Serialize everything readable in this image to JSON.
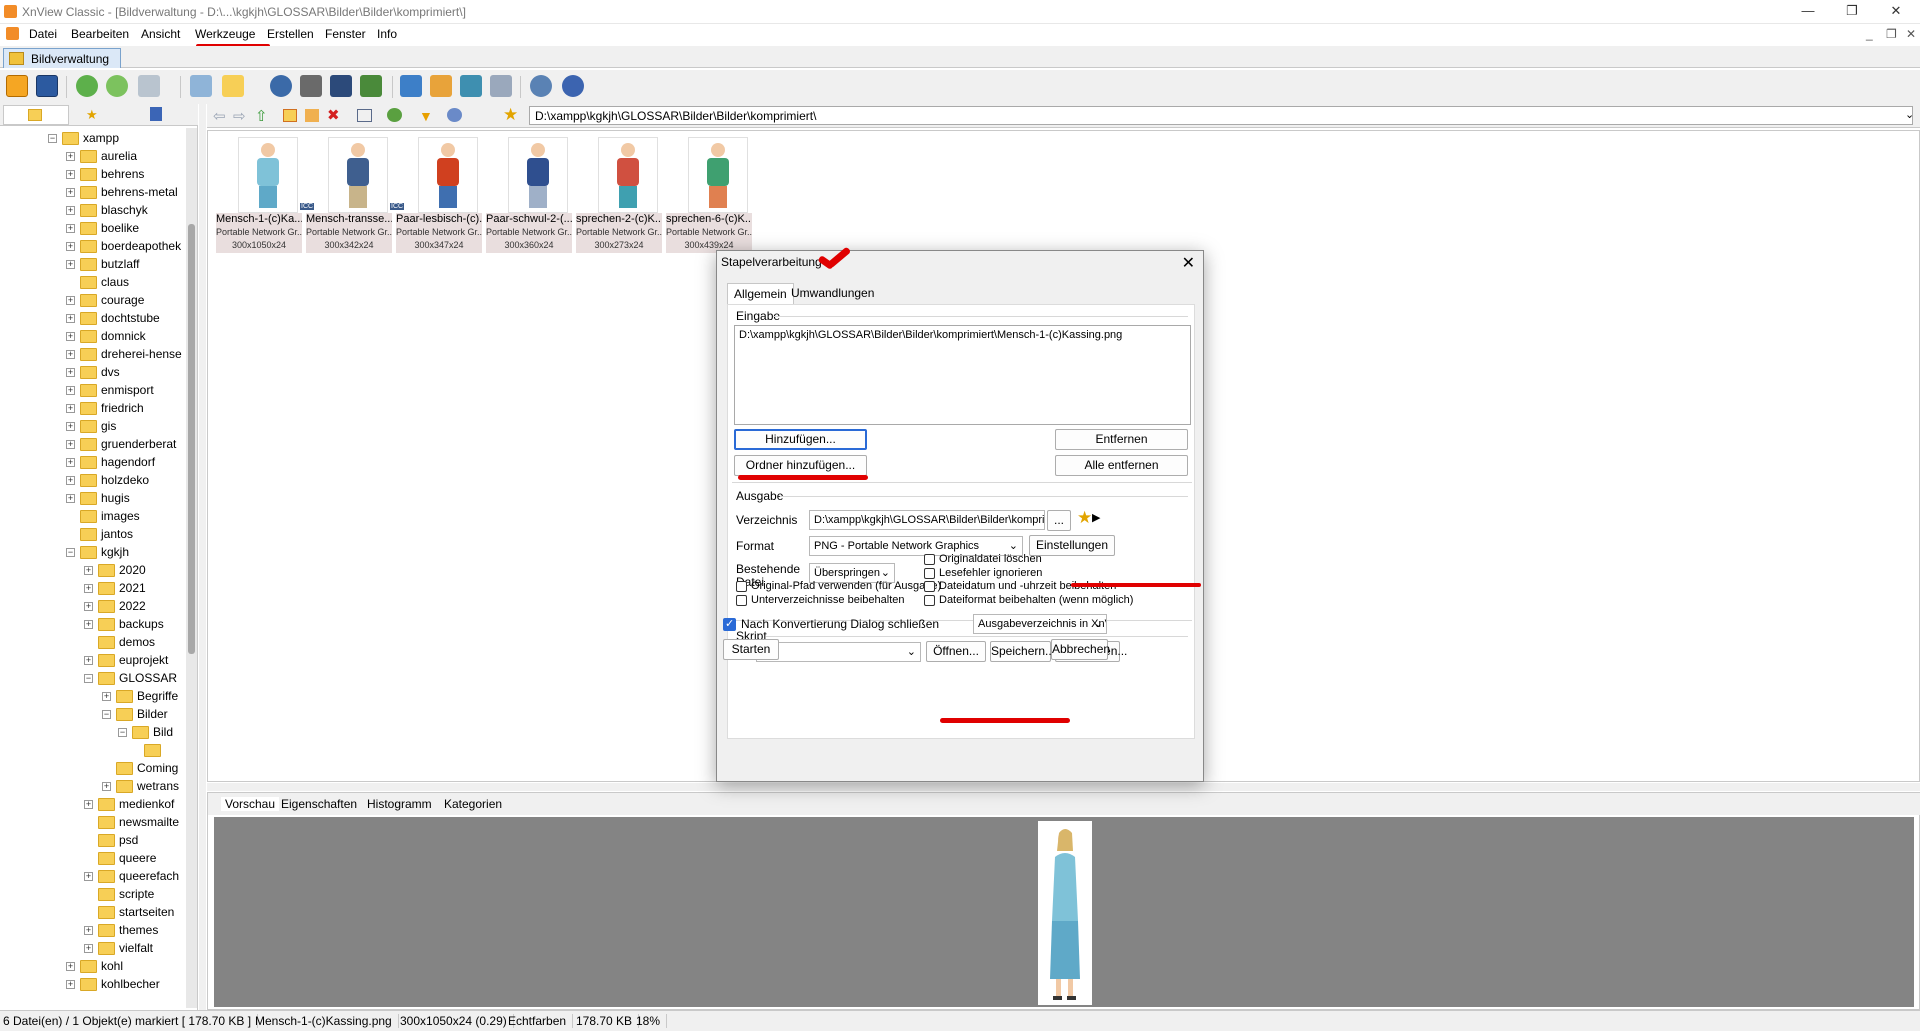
{
  "window": {
    "title": "XnView Classic - [Bildverwaltung - D:\\...\\kgkjh\\GLOSSAR\\Bilder\\Bilder\\komprimiert\\]",
    "controls": [
      "—",
      "❐",
      "✕"
    ],
    "mdi_controls": [
      "_",
      "❐",
      "✕"
    ]
  },
  "menu": [
    "Datei",
    "Bearbeiten",
    "Ansicht",
    "Werkzeuge",
    "Erstellen",
    "Fenster",
    "Info"
  ],
  "doc_tab": "Bildverwaltung",
  "address": "D:\\xampp\\kgkjh\\GLOSSAR\\Bilder\\Bilder\\komprimiert\\",
  "tree": [
    {
      "label": "xampp",
      "level": 0,
      "pm": "−"
    },
    {
      "label": "aurelia",
      "level": 1,
      "pm": "+"
    },
    {
      "label": "behrens",
      "level": 1,
      "pm": "+"
    },
    {
      "label": "behrens-metal",
      "level": 1,
      "pm": "+"
    },
    {
      "label": "blaschyk",
      "level": 1,
      "pm": "+"
    },
    {
      "label": "boelike",
      "level": 1,
      "pm": "+"
    },
    {
      "label": "boerdeapothek",
      "level": 1,
      "pm": "+"
    },
    {
      "label": "butzlaff",
      "level": 1,
      "pm": "+"
    },
    {
      "label": "claus",
      "level": 1,
      "pm": ""
    },
    {
      "label": "courage",
      "level": 1,
      "pm": "+"
    },
    {
      "label": "dochtstube",
      "level": 1,
      "pm": "+"
    },
    {
      "label": "domnick",
      "level": 1,
      "pm": "+"
    },
    {
      "label": "dreherei-hense",
      "level": 1,
      "pm": "+"
    },
    {
      "label": "dvs",
      "level": 1,
      "pm": "+"
    },
    {
      "label": "enmisport",
      "level": 1,
      "pm": "+"
    },
    {
      "label": "friedrich",
      "level": 1,
      "pm": "+"
    },
    {
      "label": "gis",
      "level": 1,
      "pm": "+"
    },
    {
      "label": "gruenderberat",
      "level": 1,
      "pm": "+"
    },
    {
      "label": "hagendorf",
      "level": 1,
      "pm": "+"
    },
    {
      "label": "holzdeko",
      "level": 1,
      "pm": "+"
    },
    {
      "label": "hugis",
      "level": 1,
      "pm": "+"
    },
    {
      "label": "images",
      "level": 1,
      "pm": ""
    },
    {
      "label": "jantos",
      "level": 1,
      "pm": ""
    },
    {
      "label": "kgkjh",
      "level": 1,
      "pm": "−"
    },
    {
      "label": "2020",
      "level": 2,
      "pm": "+"
    },
    {
      "label": "2021",
      "level": 2,
      "pm": "+"
    },
    {
      "label": "2022",
      "level": 2,
      "pm": "+"
    },
    {
      "label": "backups",
      "level": 2,
      "pm": "+"
    },
    {
      "label": "demos",
      "level": 2,
      "pm": ""
    },
    {
      "label": "euprojekt",
      "level": 2,
      "pm": "+"
    },
    {
      "label": "GLOSSAR",
      "level": 2,
      "pm": "−"
    },
    {
      "label": "Begriffe",
      "level": 3,
      "pm": "+"
    },
    {
      "label": "Bilder",
      "level": 3,
      "pm": "−"
    },
    {
      "label": "Bild",
      "level": 4,
      "pm": "−"
    },
    {
      "label": "",
      "level": 5,
      "pm": ""
    },
    {
      "label": "Coming",
      "level": 3,
      "pm": ""
    },
    {
      "label": "wetrans",
      "level": 3,
      "pm": "+"
    },
    {
      "label": "medienkof",
      "level": 2,
      "pm": "+"
    },
    {
      "label": "newsmailte",
      "level": 2,
      "pm": ""
    },
    {
      "label": "psd",
      "level": 2,
      "pm": ""
    },
    {
      "label": "queere",
      "level": 2,
      "pm": ""
    },
    {
      "label": "queerefach",
      "level": 2,
      "pm": "+"
    },
    {
      "label": "scripte",
      "level": 2,
      "pm": ""
    },
    {
      "label": "startseiten",
      "level": 2,
      "pm": ""
    },
    {
      "label": "themes",
      "level": 2,
      "pm": "+"
    },
    {
      "label": "vielfalt",
      "level": 2,
      "pm": "+"
    },
    {
      "label": "kohl",
      "level": 1,
      "pm": "+"
    },
    {
      "label": "kohlbecher",
      "level": 1,
      "pm": "+"
    }
  ],
  "thumbnails": [
    {
      "name": "Mensch-1-(c)Ka...",
      "type": "Portable Network Gr...",
      "size": "300x1050x24",
      "icc": "ICC"
    },
    {
      "name": "Mensch-transse...",
      "type": "Portable Network Gr...",
      "size": "300x342x24",
      "icc": "ICC"
    },
    {
      "name": "Paar-lesbisch-(c)...",
      "type": "Portable Network Gr...",
      "size": "300x347x24",
      "icc": ""
    },
    {
      "name": "Paar-schwul-2-(...",
      "type": "Portable Network Gr...",
      "size": "300x360x24",
      "icc": ""
    },
    {
      "name": "sprechen-2-(c)K...",
      "type": "Portable Network Gr...",
      "size": "300x273x24",
      "icc": ""
    },
    {
      "name": "sprechen-6-(c)K...",
      "type": "Portable Network Gr...",
      "size": "300x439x24",
      "icc": ""
    }
  ],
  "bottom_tabs": [
    "Vorschau",
    "Eigenschaften",
    "Histogramm",
    "Kategorien"
  ],
  "status": {
    "files": "6 Datei(en) / 1 Objekt(e) markiert  [ 178.70 KB ]",
    "filename": "Mensch-1-(c)Kassing.png",
    "dims": "300x1050x24 (0.29)",
    "color": "Echtfarben",
    "size": "178.70 KB",
    "zoom": "18%"
  },
  "dialog": {
    "title": "Stapelverarbeitung",
    "tabs": [
      "Allgemein",
      "Umwandlungen"
    ],
    "input_group": "Eingabe",
    "input_list": [
      "D:\\xampp\\kgkjh\\GLOSSAR\\Bilder\\Bilder\\komprimiert\\Mensch-1-(c)Kassing.png"
    ],
    "btn_add": "Hinzufügen...",
    "btn_remove": "Entfernen",
    "btn_add_folder": "Ordner hinzufügen...",
    "btn_remove_all": "Alle entfernen",
    "output_group": "Ausgabe",
    "dir_label": "Verzeichnis",
    "dir_value": "D:\\xampp\\kgkjh\\GLOSSAR\\Bilder\\Bilder\\komprimiert",
    "dir_browse": "...",
    "format_label": "Format",
    "format_value": "PNG - Portable Network Graphics",
    "settings_btn": "Einstellungen",
    "existing_label": "Bestehende Datei",
    "existing_value": "Überspringen",
    "checks": [
      {
        "label": "Originaldatei löschen",
        "checked": false
      },
      {
        "label": "Lesefehler ignorieren",
        "checked": false
      },
      {
        "label": "Original-Pfad verwenden (für Ausgabe)",
        "checked": false
      },
      {
        "label": "Dateidatum und -uhrzeit beibehalten",
        "checked": false
      },
      {
        "label": "Unterverzeichnisse beibehalten",
        "checked": false
      },
      {
        "label": "Dateiformat beibehalten (wenn möglich)",
        "checked": false
      }
    ],
    "script_group": "Skript",
    "btn_open": "Öffnen...",
    "btn_save": "Speichern...",
    "btn_export": "Exportieren...",
    "close_after": "Nach Konvertierung Dialog schließen",
    "close_after_checked": true,
    "output_in": "Ausgabeverzeichnis in XnView",
    "btn_start": "Starten",
    "btn_cancel": "Abbrechen"
  },
  "colors": {
    "annotation": "#e00000",
    "accent": "#2a6ad6",
    "folder": "#f7cf56",
    "caption_bg": "#e9dede"
  },
  "icons": [
    "app-icon",
    "home-icon",
    "fullscreen-icon",
    "refresh-icon",
    "rotate-icon",
    "slideshow-icon",
    "search-icon",
    "print-icon",
    "scan-icon",
    "settings-icon",
    "info-icon",
    "back-arrow-icon",
    "forward-arrow-icon",
    "up-arrow-icon",
    "star-icon"
  ]
}
